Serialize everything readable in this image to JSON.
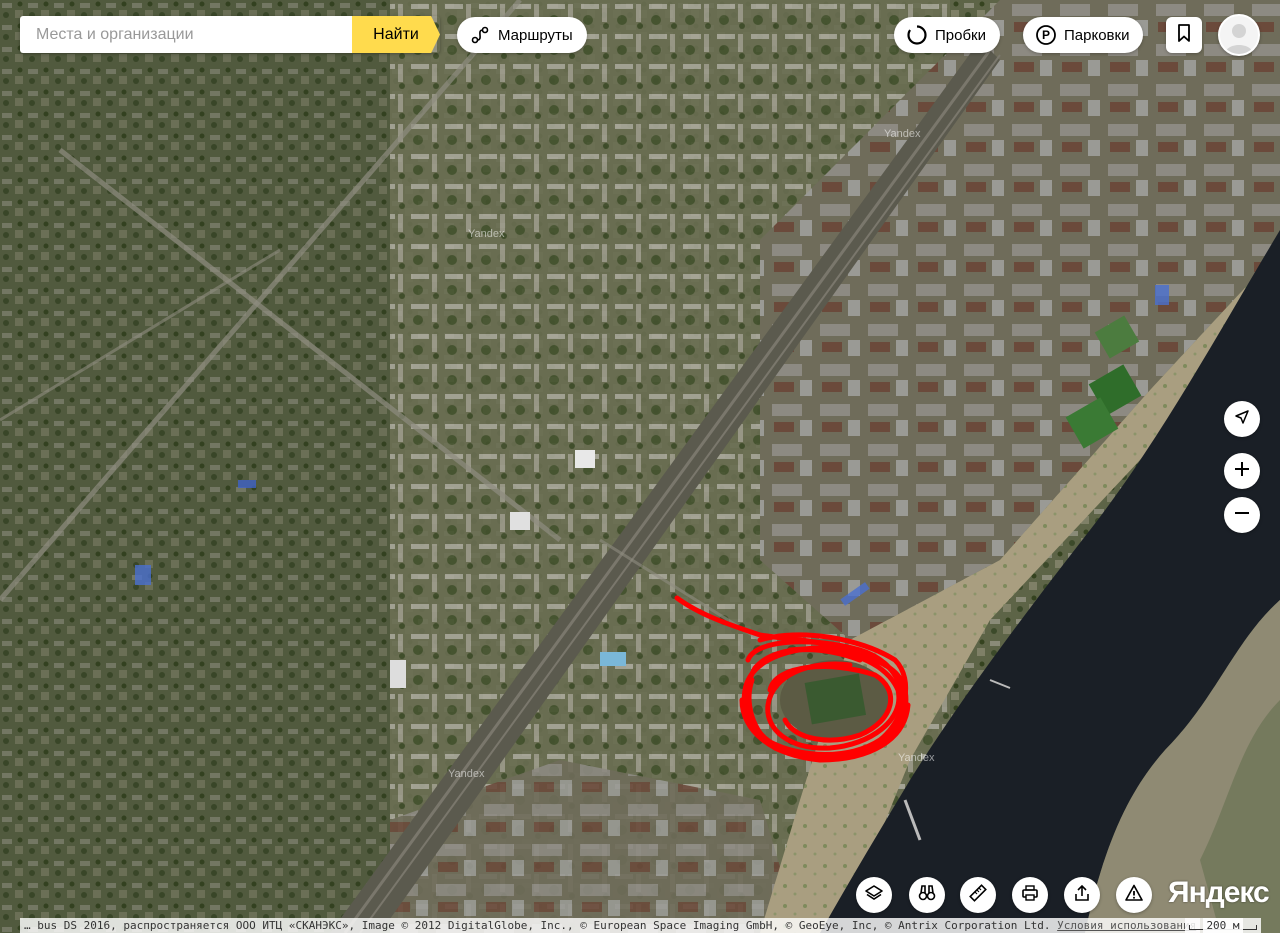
{
  "search": {
    "placeholder": "Места и организации",
    "button_label": "Найти"
  },
  "routes": {
    "label": "Маршруты"
  },
  "traffic": {
    "label": "Пробки"
  },
  "parking": {
    "label": "Парковки",
    "icon_letter": "P"
  },
  "map": {
    "watermark": "Yandex",
    "logo": "Яндекс",
    "copyright": "… bus DS 2016, распространяется ООО ИТЦ «СКАНЭКС», Image © 2012 DigitalGlobe, Inc., © European Space Imaging GmbH, © GeoEye, Inc, © Antrix Corporation Ltd.",
    "terms_link": "Условия использования",
    "scale_label": "200 м",
    "drawn_track_color": "#ff0000",
    "river_color": "#1a1f26"
  },
  "controls": {
    "locate_icon": "navigation-arrow-icon",
    "zoom_in_icon": "plus-icon",
    "zoom_out_icon": "minus-icon",
    "tools": [
      "layers-icon",
      "panorama-binoculars-icon",
      "ruler-icon",
      "print-icon",
      "share-icon",
      "report-error-icon"
    ]
  }
}
